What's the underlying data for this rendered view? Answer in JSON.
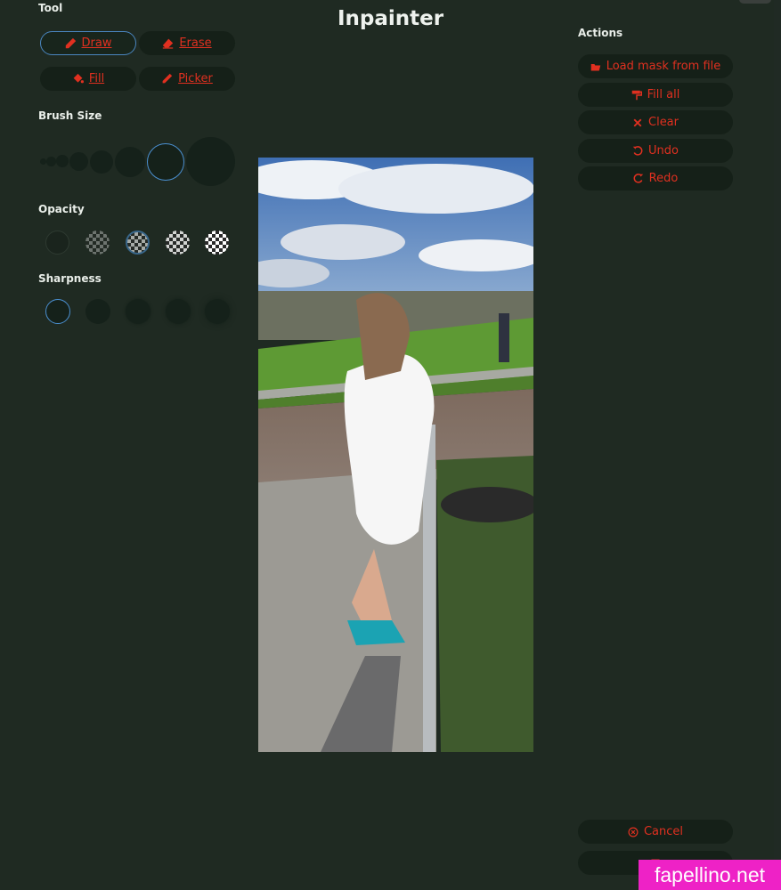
{
  "app": {
    "title": "Inpainter"
  },
  "tool": {
    "heading": "Tool",
    "buttons": [
      {
        "label": "Draw",
        "icon": "pencil-icon",
        "active": true
      },
      {
        "label": "Erase",
        "icon": "eraser-icon",
        "active": false
      },
      {
        "label": "Fill",
        "icon": "paint-bucket-icon",
        "active": false
      },
      {
        "label": "Picker",
        "icon": "eyedropper-icon",
        "active": false
      }
    ]
  },
  "brush_size": {
    "heading": "Brush Size",
    "selected_index": 5,
    "option_count": 7
  },
  "opacity": {
    "heading": "Opacity",
    "selected_index": 2,
    "levels": [
      0,
      0.25,
      0.5,
      0.75,
      1
    ]
  },
  "sharpness": {
    "heading": "Sharpness",
    "selected_index": 0,
    "option_count": 5
  },
  "actions": {
    "heading": "Actions",
    "load_mask": "Load mask from file",
    "fill_all": "Fill all",
    "clear": "Clear",
    "undo": "Undo",
    "redo": "Redo",
    "cancel": "Cancel"
  },
  "watermark": "fapellino.net",
  "colors": {
    "background": "#1f2a22",
    "button_bg": "#152018",
    "accent_text": "#e03020",
    "selection_ring": "#4a86c0"
  }
}
